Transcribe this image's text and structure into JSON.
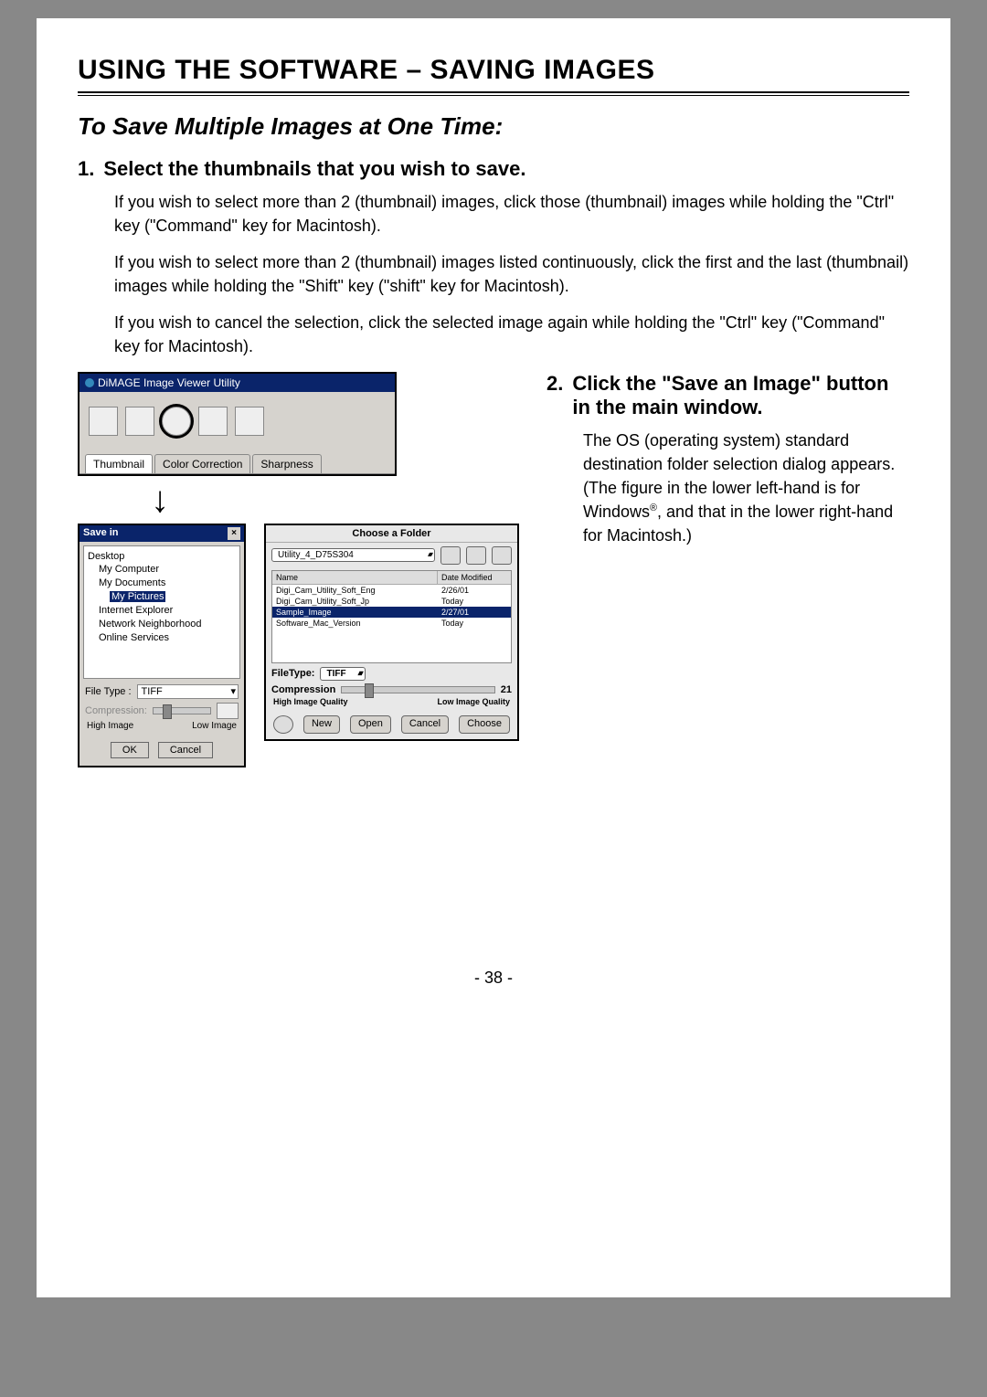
{
  "page_title": "USING THE SOFTWARE – SAVING IMAGES",
  "section_title": "To Save Multiple Images at One Time:",
  "step1": {
    "num": "1.",
    "head": "Select the thumbnails that you wish to save.",
    "p1": "If you wish to select more than 2 (thumbnail) images, click those (thumbnail) images while holding the \"Ctrl\" key (\"Command\" key for Macintosh).",
    "p2": "If you wish to select more than 2 (thumbnail) images listed continuously, click the first and the last (thumbnail) images while holding the \"Shift\" key (\"shift\" key for Macintosh).",
    "p3": "If you wish to cancel the selection, click the selected image again while holding the \"Ctrl\" key (\"Command\" key for Macintosh)."
  },
  "app_window": {
    "title": "DiMAGE Image Viewer Utility",
    "tabs": [
      "Thumbnail",
      "Color Correction",
      "Sharpness"
    ]
  },
  "step2": {
    "num": "2.",
    "head": "Click the \"Save an Image\" button in the main window.",
    "p1_before_sup": "The OS (operating system) standard destination folder selection dialog appears. (The figure in the lower left-hand is for Windows",
    "sup": "®",
    "p1_after_sup": ", and that in the lower right-hand for Macintosh.)"
  },
  "win_dialog": {
    "title": "Save in",
    "close": "×",
    "tree": {
      "desktop": "Desktop",
      "mycomputer": "My Computer",
      "mydocs": "My Documents",
      "mypics": "My Pictures",
      "ie": "Internet Explorer",
      "netnbr": "Network Neighborhood",
      "online": "Online Services"
    },
    "filetype_label": "File Type :",
    "filetype_value": "TIFF",
    "compression_label": "Compression:",
    "hi": "High Image",
    "lo": "Low Image",
    "ok": "OK",
    "cancel": "Cancel"
  },
  "mac_dialog": {
    "title": "Choose a Folder",
    "popup": "Utility_4_D75S304",
    "col_name": "Name",
    "col_date": "Date Modified",
    "rows": [
      {
        "name": "Digi_Cam_Utility_Soft_Eng",
        "date": "2/26/01"
      },
      {
        "name": "Digi_Cam_Utility_Soft_Jp",
        "date": "Today"
      },
      {
        "name": "Sample_Image",
        "date": "2/27/01"
      },
      {
        "name": "Software_Mac_Version",
        "date": "Today"
      }
    ],
    "filetype_label": "FileType:",
    "filetype_value": "TIFF",
    "compression_label": "Compression",
    "compression_value": "21",
    "hi": "High Image Quality",
    "lo": "Low Image Quality",
    "new": "New",
    "open": "Open",
    "cancel": "Cancel",
    "choose": "Choose"
  },
  "page_number": "- 38 -"
}
